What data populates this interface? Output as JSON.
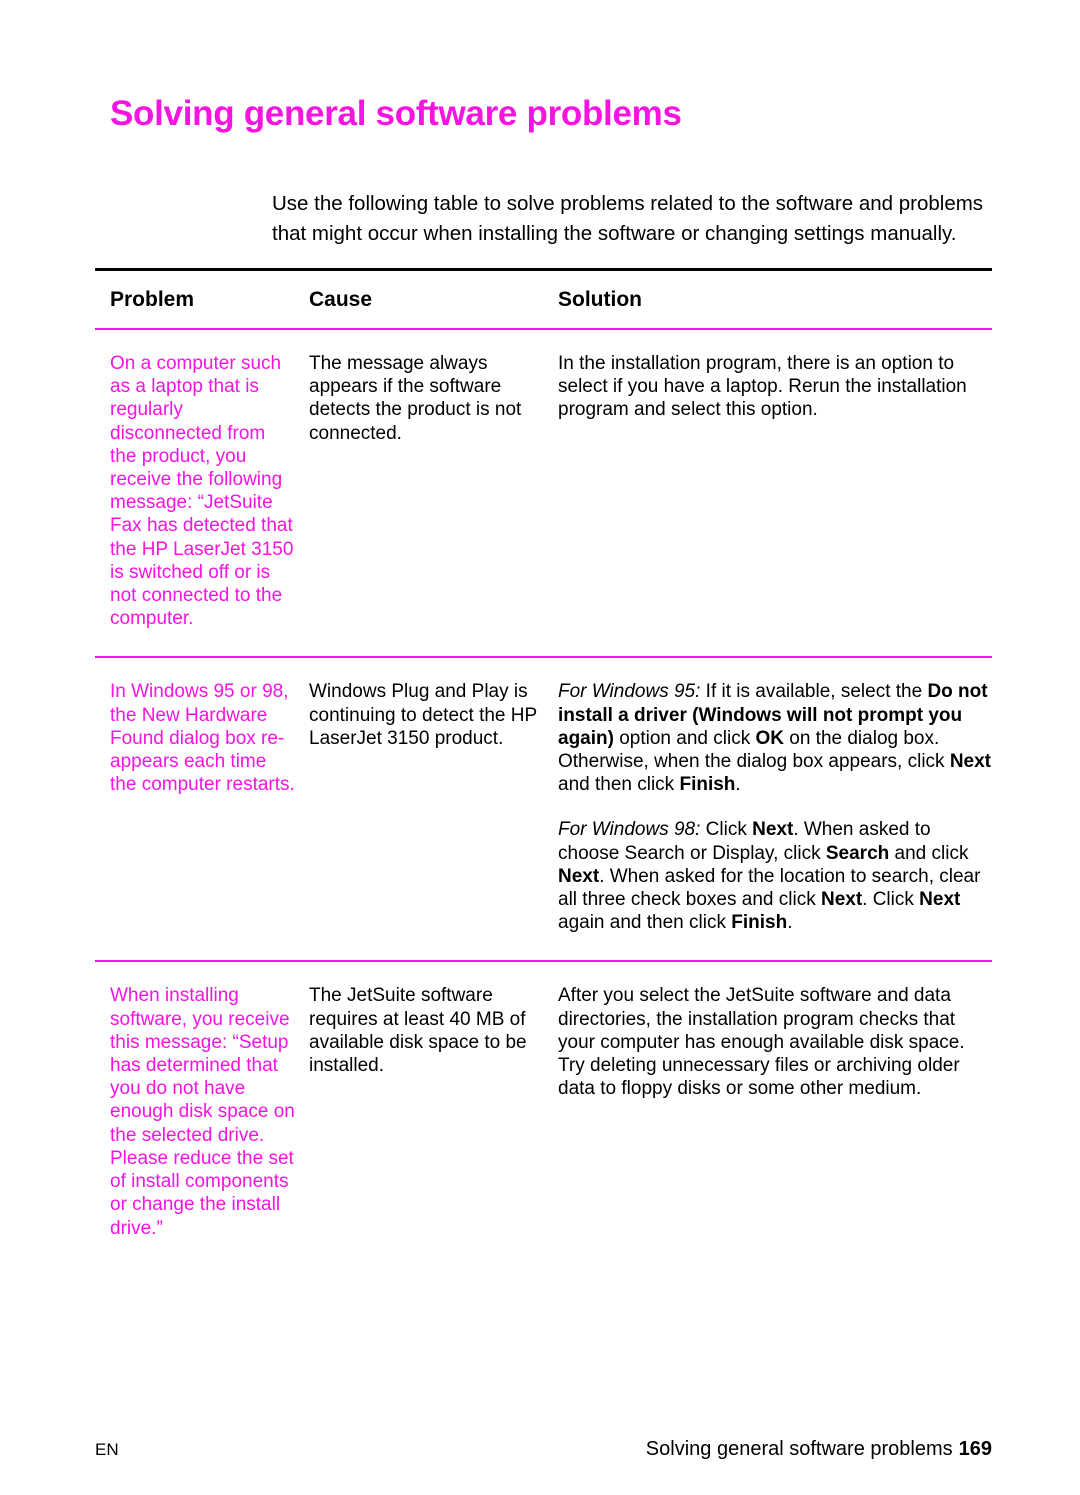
{
  "document": {
    "title": "Solving general software problems",
    "title_color": "#f514e0",
    "intro": "Use the following table to solve problems related to the software and problems that might occur when installing the software or changing settings manually."
  },
  "table": {
    "headers": {
      "problem": "Problem",
      "cause": "Cause",
      "solution": "Solution"
    },
    "rows": [
      {
        "problem": "On a computer such as a laptop that is regularly disconnected from the product, you receive the following message: “JetSuite Fax has detected that the HP LaserJet 3150 is switched off or is not connected to the computer.",
        "cause": "The message always appears if the software detects the product is not connected.",
        "solution_paragraphs": [
          [
            {
              "t": "In the installation program, there is an option to select if you have a laptop. Rerun the installation program and select this option.",
              "s": "n"
            }
          ]
        ]
      },
      {
        "problem": "In Windows 95 or 98, the New Hardware Found dialog box re-appears each time the computer restarts.",
        "cause": "Windows Plug and Play is continuing to detect the HP LaserJet 3150 product.",
        "solution_paragraphs": [
          [
            {
              "t": "For Windows 95:",
              "s": "i"
            },
            {
              "t": " If it is available, select the ",
              "s": "n"
            },
            {
              "t": "Do not install a driver (Windows will not prompt you again)",
              "s": "b"
            },
            {
              "t": " option and click ",
              "s": "n"
            },
            {
              "t": "OK",
              "s": "b"
            },
            {
              "t": " on the dialog box. Otherwise, when the dialog box appears, click ",
              "s": "n"
            },
            {
              "t": "Next",
              "s": "b"
            },
            {
              "t": " and then click ",
              "s": "n"
            },
            {
              "t": "Finish",
              "s": "b"
            },
            {
              "t": ".",
              "s": "n"
            }
          ],
          [
            {
              "t": "For Windows 98:",
              "s": "i"
            },
            {
              "t": " Click ",
              "s": "n"
            },
            {
              "t": "Next",
              "s": "b"
            },
            {
              "t": ". When asked to choose Search or Display, click ",
              "s": "n"
            },
            {
              "t": "Search",
              "s": "b"
            },
            {
              "t": " and click ",
              "s": "n"
            },
            {
              "t": "Next",
              "s": "b"
            },
            {
              "t": ". When asked for the location to search, clear all three check boxes and click ",
              "s": "n"
            },
            {
              "t": "Next",
              "s": "b"
            },
            {
              "t": ". Click ",
              "s": "n"
            },
            {
              "t": "Next",
              "s": "b"
            },
            {
              "t": " again and then click ",
              "s": "n"
            },
            {
              "t": "Finish",
              "s": "b"
            },
            {
              "t": ".",
              "s": "n"
            }
          ]
        ]
      },
      {
        "problem": "When installing software, you receive this message: “Setup has determined that you do not have enough disk space on the selected drive. Please reduce the set of install components or change the install drive.”",
        "cause": "The JetSuite software requires at least 40 MB of available disk space to be installed.",
        "solution_paragraphs": [
          [
            {
              "t": "After you select the JetSuite software and data directories, the installation program checks that your computer has enough available disk space. Try deleting unnecessary files or archiving older data to floppy disks or some other medium.",
              "s": "n"
            }
          ]
        ]
      }
    ]
  },
  "footer": {
    "language": "EN",
    "running_title": "Solving general software problems",
    "page_number": "169"
  }
}
